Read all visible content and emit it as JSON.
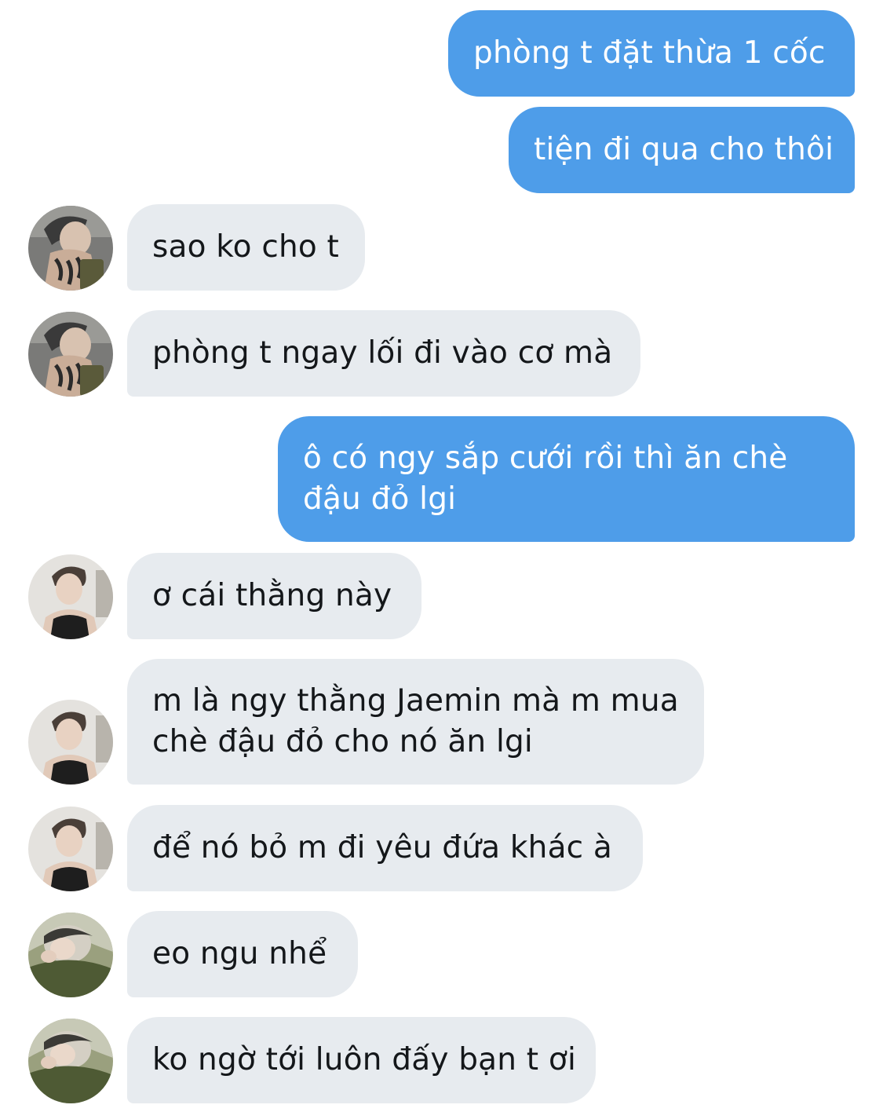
{
  "messages": [
    {
      "direction": "outgoing",
      "lines": [
        "phòng t đặt thừa 1 cốc"
      ]
    },
    {
      "direction": "outgoing",
      "lines": [
        "tiện đi qua cho thôi"
      ]
    },
    {
      "direction": "incoming",
      "sender_avatar": "avatar-tattoo-neck",
      "lines": [
        "sao ko cho t"
      ]
    },
    {
      "direction": "incoming",
      "sender_avatar": "avatar-tattoo-neck",
      "lines": [
        "phòng t ngay lối đi vào cơ mà"
      ]
    },
    {
      "direction": "outgoing",
      "lines": [
        "ô có ngy sắp cưới rồi thì ăn chè",
        "đậu đỏ lgi"
      ]
    },
    {
      "direction": "incoming",
      "sender_avatar": "avatar-tank-top",
      "lines": [
        "ơ cái thằng này"
      ]
    },
    {
      "direction": "incoming",
      "sender_avatar": "avatar-tank-top",
      "lines": [
        "m là ngy thằng Jaemin mà m mua",
        "chè đậu đỏ cho nó ăn lgi"
      ]
    },
    {
      "direction": "incoming",
      "sender_avatar": "avatar-tank-top",
      "lines": [
        "để nó bỏ m đi yêu đứa khác à"
      ]
    },
    {
      "direction": "incoming",
      "sender_avatar": "avatar-green-hood",
      "lines": [
        "eo ngu nhể"
      ]
    },
    {
      "direction": "incoming",
      "sender_avatar": "avatar-green-hood",
      "lines": [
        "ko ngờ tới luôn đấy bạn t ơi"
      ]
    }
  ],
  "colors": {
    "outgoing_bubble": "#4e9de9",
    "incoming_bubble": "#e7ebef",
    "outgoing_text": "#ffffff",
    "incoming_text": "#14171a"
  }
}
